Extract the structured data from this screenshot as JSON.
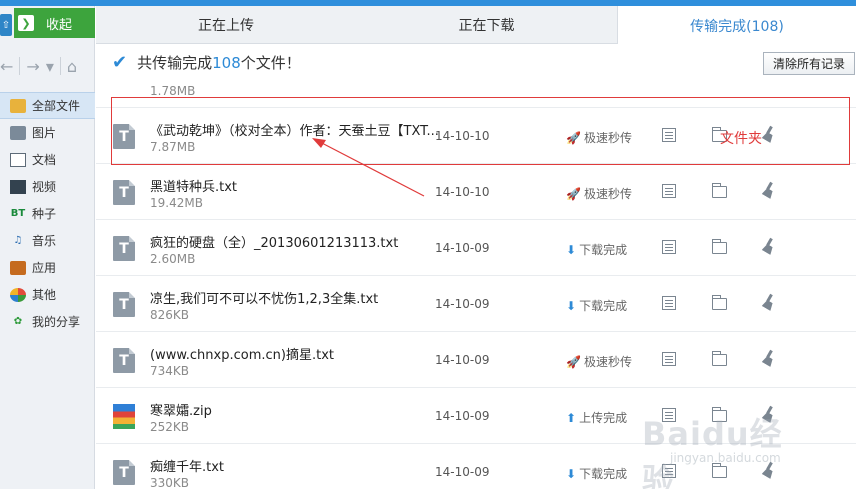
{
  "sidebar": {
    "collapse_label": "收起",
    "collapse_arrow": "❯",
    "categories": [
      {
        "label": "全部文件",
        "icon": "folder-icon"
      },
      {
        "label": "图片",
        "icon": "image-icon"
      },
      {
        "label": "文档",
        "icon": "document-icon"
      },
      {
        "label": "视频",
        "icon": "video-icon"
      },
      {
        "label": "种子",
        "icon": "bt-icon",
        "icon_text": "BT"
      },
      {
        "label": "音乐",
        "icon": "music-icon",
        "icon_text": "♫"
      },
      {
        "label": "应用",
        "icon": "app-icon"
      },
      {
        "label": "其他",
        "icon": "other-icon"
      },
      {
        "label": "我的分享",
        "icon": "share-icon",
        "icon_text": "✿"
      }
    ],
    "nav": {
      "back": "←",
      "forward": "→",
      "dropdown": "▾",
      "home": "⌂"
    }
  },
  "tabs": [
    {
      "label": "正在上传"
    },
    {
      "label": "正在下载"
    },
    {
      "label": "传输完成(108)"
    }
  ],
  "summary": {
    "check": "✔",
    "prefix": "共传输完成",
    "count": "108",
    "suffix": "个文件！",
    "clear_label": "清除所有记录"
  },
  "partial_row": {
    "size": "1.78MB"
  },
  "rows": [
    {
      "name": "《武动乾坤》（校对全本）作者：天蚕土豆【TXT...",
      "size": "7.87MB",
      "date": "14-10-10",
      "status": "极速秒传",
      "status_type": "fast",
      "icon": "T",
      "type": "txt"
    },
    {
      "name": "黑道特种兵.txt",
      "size": "19.42MB",
      "date": "14-10-10",
      "status": "极速秒传",
      "status_type": "fast",
      "icon": "T",
      "type": "txt"
    },
    {
      "name": "疯狂的硬盘（全）_20130601213113.txt",
      "size": "2.60MB",
      "date": "14-10-09",
      "status": "下载完成",
      "status_type": "down",
      "icon": "T",
      "type": "txt"
    },
    {
      "name": "凉生,我们可不可以不忧伤1,2,3全集.txt",
      "size": "826KB",
      "date": "14-10-09",
      "status": "下载完成",
      "status_type": "down",
      "icon": "T",
      "type": "txt"
    },
    {
      "name": "(www.chnxp.com.cn)摘星.txt",
      "size": "734KB",
      "date": "14-10-09",
      "status": "极速秒传",
      "status_type": "fast",
      "icon": "T",
      "type": "txt"
    },
    {
      "name": "寒翠孀.zip",
      "size": "252KB",
      "date": "14-10-09",
      "status": "上传完成",
      "status_type": "up",
      "icon": "",
      "type": "zip"
    },
    {
      "name": "痴缠千年.txt",
      "size": "330KB",
      "date": "14-10-09",
      "status": "下载完成",
      "status_type": "down",
      "icon": "T",
      "type": "txt"
    }
  ],
  "status_glyphs": {
    "fast": "🚀",
    "down": "⬇",
    "up": "⬆"
  },
  "annotation": {
    "label": "文件夹",
    "color": "#e03b3b"
  },
  "watermark": {
    "main": "Baidu经验",
    "sub": "jingyan.baidu.com"
  },
  "colors": {
    "accent": "#2d8ad6",
    "green": "#3da43d",
    "annotation": "#e03b3b"
  }
}
